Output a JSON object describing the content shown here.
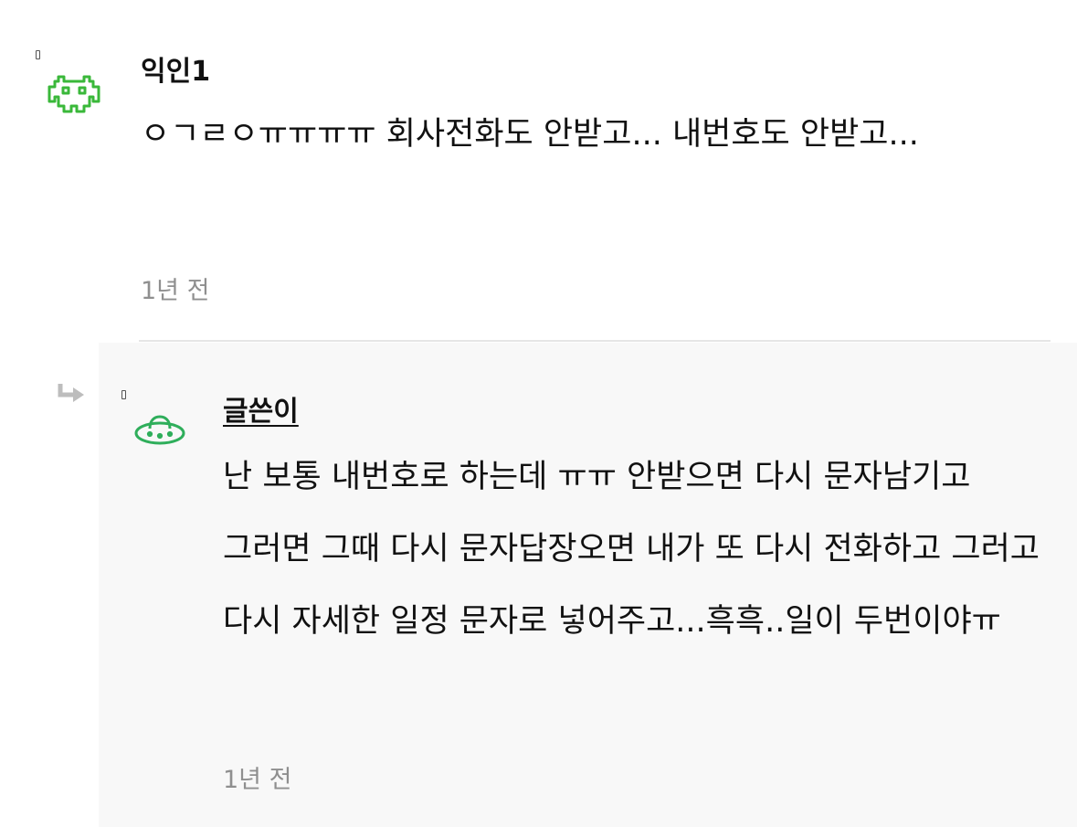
{
  "comments": [
    {
      "author": "익인1",
      "avatar_icon": "space-invader-icon",
      "avatar_color": "#3ab83a",
      "content": "ㅇㄱㄹㅇㅠㅠㅠㅠ 회사전화도 안받고... 내번호도 안받고...",
      "time": "1년 전"
    },
    {
      "author": "글쓴이",
      "avatar_icon": "ufo-icon",
      "avatar_color": "#2fae5b",
      "is_reply": true,
      "content": "난 보통 내번호로 하는데 ㅠㅠ 안받으면 다시 문자남기고 그러면 그때 다시 문자답장오면 내가 또 다시 전화하고 그러고 다시 자세한 일정 문자로 넣어주고...흑흑..일이 두번이야ㅠ",
      "time": "1년 전"
    }
  ]
}
